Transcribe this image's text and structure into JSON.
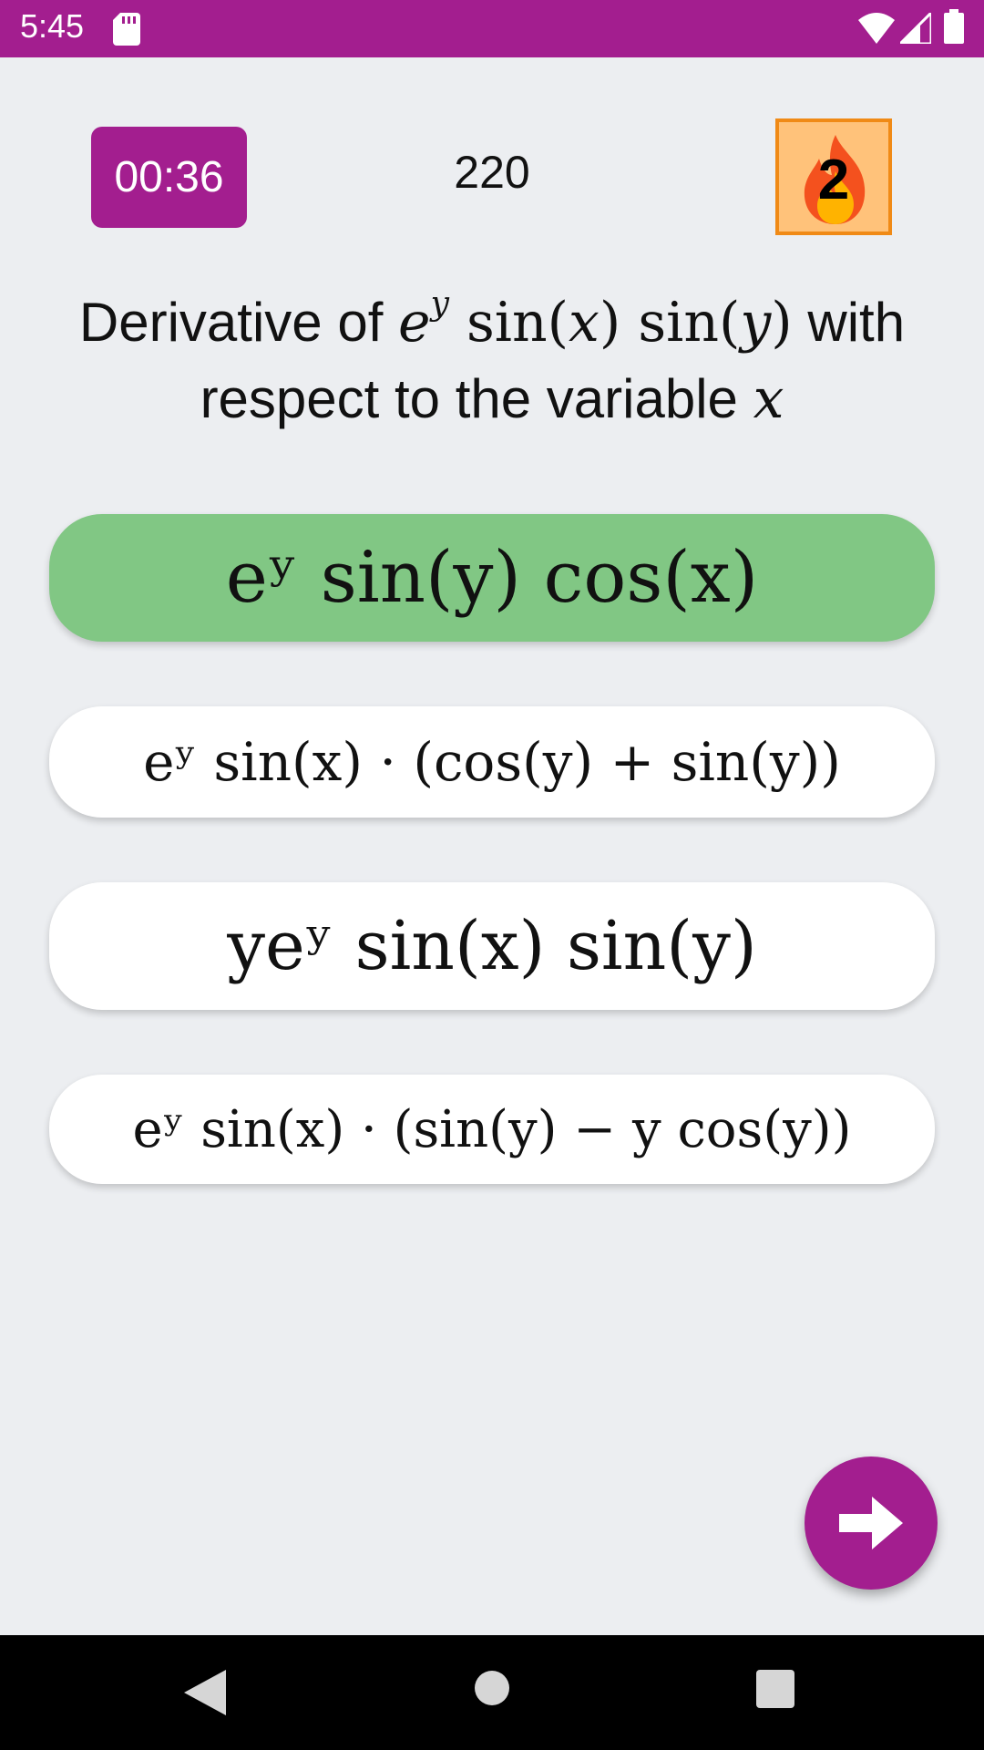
{
  "status_bar": {
    "time": "5:45",
    "icons": [
      "sd-card-icon",
      "wifi-icon",
      "signal-icon",
      "battery-icon"
    ]
  },
  "header": {
    "timer": "00:36",
    "score": "220",
    "streak": "2",
    "streak_icon": "fire-icon"
  },
  "question": {
    "prefix": "Derivative of ",
    "func_e": "e",
    "func_exp": "y",
    "func_rest_1": " sin(",
    "func_x": "x",
    "func_rest_2": ") sin(",
    "func_y": "y",
    "func_rest_3": ")",
    "middle": " with respect to the variable ",
    "variable": "x"
  },
  "options": [
    {
      "text": "eʸ sin(y) cos(x)",
      "correct": true
    },
    {
      "text": "eʸ sin(x) · (cos(y) + sin(y))",
      "correct": false
    },
    {
      "text": "yeʸ sin(x) sin(y)",
      "correct": false
    },
    {
      "text": "eʸ sin(x) · (sin(y) − y cos(y))",
      "correct": false
    }
  ],
  "next_button": {
    "icon": "arrow-right-icon"
  },
  "nav_bar": {
    "icons": [
      "back-icon",
      "home-icon",
      "recents-icon"
    ]
  },
  "colors": {
    "primary": "#a31e8f",
    "correct": "#81c784",
    "streak_bg": "#ffc27a",
    "streak_border": "#f08a16",
    "background": "#eceef1"
  }
}
